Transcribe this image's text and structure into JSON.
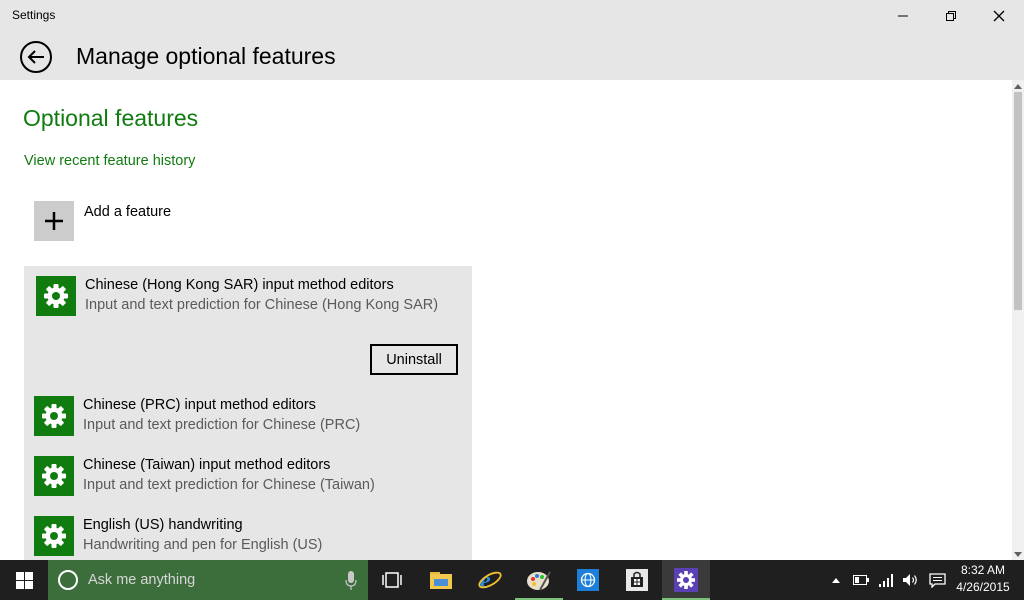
{
  "window": {
    "title": "Settings"
  },
  "header": {
    "title": "Manage optional features"
  },
  "main": {
    "section_title": "Optional features",
    "history_link": "View recent feature history",
    "add_feature_label": "Add a feature",
    "uninstall_label": "Uninstall",
    "features": [
      {
        "name": "Chinese (Hong Kong SAR) input method editors",
        "description": "Input and text prediction for Chinese (Hong Kong SAR)",
        "selected": true
      },
      {
        "name": "Chinese (PRC) input method editors",
        "description": "Input and text prediction for Chinese (PRC)"
      },
      {
        "name": "Chinese (Taiwan) input method editors",
        "description": "Input and text prediction for Chinese (Taiwan)"
      },
      {
        "name": "English (US) handwriting",
        "description": "Handwriting and pen for English (US)"
      }
    ]
  },
  "taskbar": {
    "search_placeholder": "Ask me anything",
    "apps": [
      "task-view-icon",
      "file-explorer-icon",
      "internet-explorer-icon",
      "paint-icon",
      "globe-icon",
      "store-icon",
      "settings-icon"
    ],
    "clock": {
      "time": "8:32 AM",
      "date": "4/26/2015"
    }
  },
  "colors": {
    "accent": "#107c10",
    "taskbar": "#1f1f1f",
    "search_box": "#3c6e3c",
    "header_bg": "#e6e6e6"
  }
}
